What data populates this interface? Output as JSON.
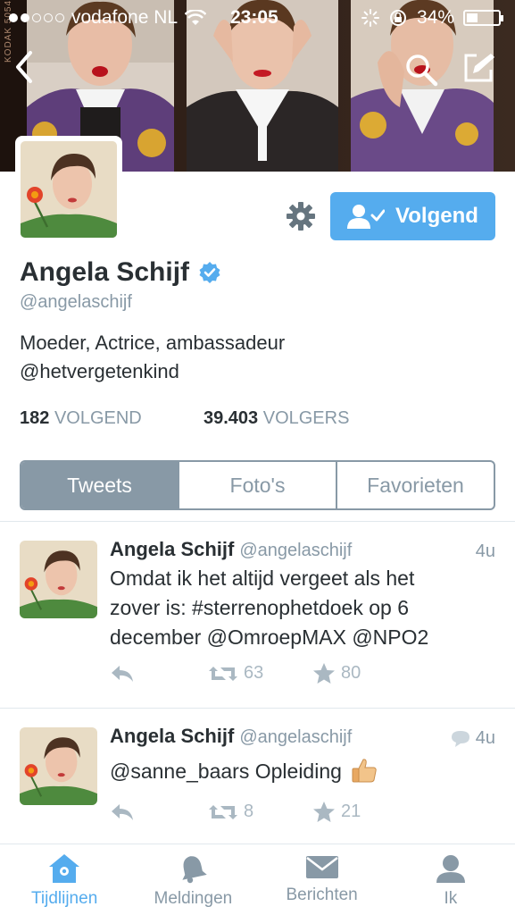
{
  "status_bar": {
    "carrier": "vodafone NL",
    "time": "23:05",
    "battery": "34%",
    "battery_level": 0.34,
    "signal_bars_filled": 2,
    "signal_bars_total": 5
  },
  "banner": {
    "film_text": "KODAK 5054"
  },
  "profile": {
    "name": "Angela Schijf",
    "handle": "@angelaschijf",
    "bio_line1": "Moeder, Actrice, ambassadeur",
    "bio_line2": "@hetvergetenkind",
    "following_count": "182",
    "following_label": "VOLGEND",
    "followers_count": "39.403",
    "followers_label": "VOLGERS",
    "follow_button_label": "Volgend",
    "verified": true
  },
  "segments": {
    "items": [
      "Tweets",
      "Foto's",
      "Favorieten"
    ],
    "active": "Tweets"
  },
  "tweets": [
    {
      "name": "Angela Schijf",
      "handle": "@angelaschijf",
      "time": "4u",
      "line1": "Omdat ik het altijd vergeet als het",
      "line2": "zover is: #sterrenophetdoek op 6",
      "line3": "december @OmroepMAX @NPO2",
      "retweets": "63",
      "favorites": "80"
    },
    {
      "name": "Angela Schijf",
      "handle": "@angelaschijf",
      "time": "4u",
      "text": "@sanne_baars Opleiding",
      "emoji": "thumbs-up",
      "retweets": "8",
      "favorites": "21",
      "has_conversation_icon": true
    }
  ],
  "tabbar": {
    "items": [
      "Tijdlijnen",
      "Meldingen",
      "Berichten",
      "Ik"
    ],
    "active": "Tijdlijnen"
  },
  "colors": {
    "accent": "#55acee",
    "muted": "#8899a6",
    "text": "#292f33",
    "icon_light": "#aab8c2"
  }
}
